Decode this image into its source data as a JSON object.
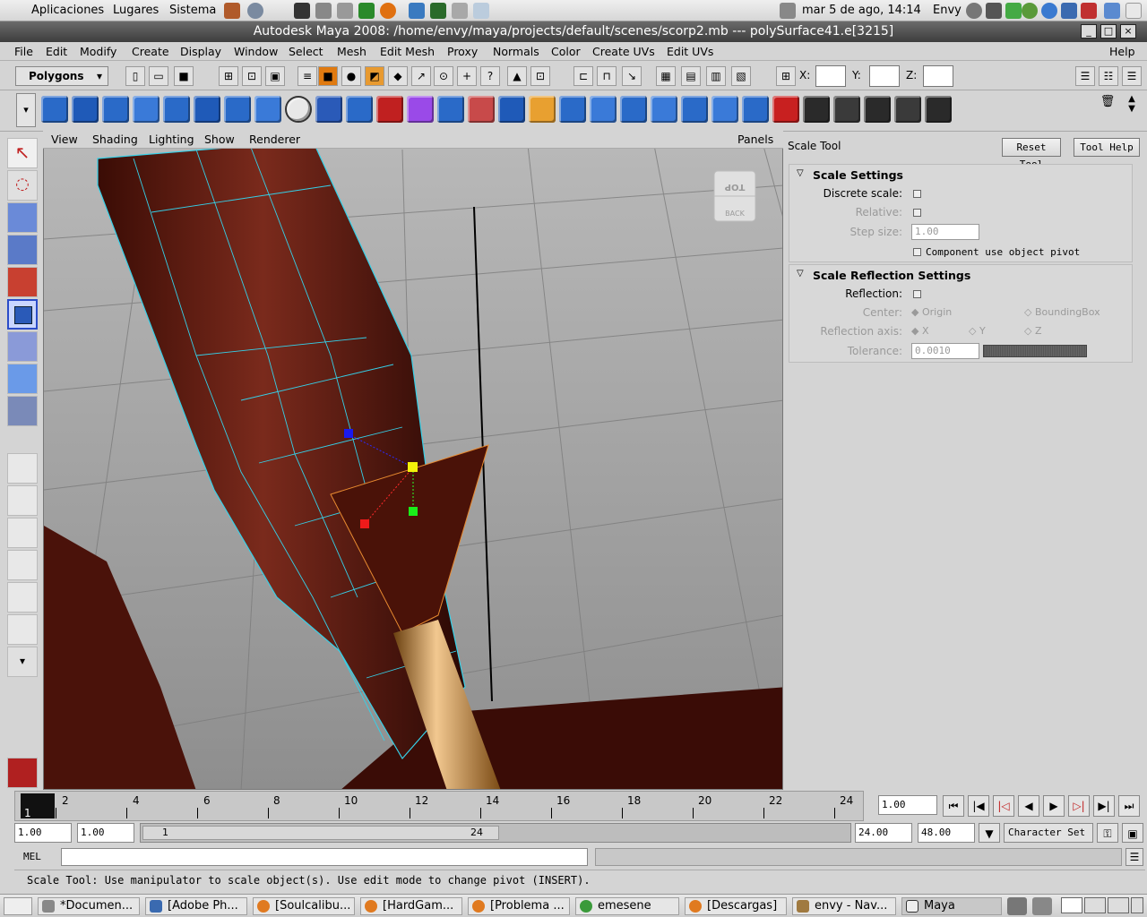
{
  "gnome_panel": {
    "menus": [
      "Aplicaciones",
      "Lugares",
      "Sistema"
    ],
    "clock": "mar  5 de ago, 14:14",
    "user": "Envy"
  },
  "window": {
    "title": "Autodesk Maya 2008: /home/envy/maya/projects/default/scenes/scorp2.mb   ---   polySurface41.e[3215]"
  },
  "menubar": [
    "File",
    "Edit",
    "Modify",
    "Create",
    "Display",
    "Window",
    "Select",
    "Mesh",
    "Edit Mesh",
    "Proxy",
    "Normals",
    "Color",
    "Create UVs",
    "Edit UVs",
    "Help"
  ],
  "status_line": {
    "menu_set": "Polygons",
    "x_label": "X:",
    "y_label": "Y:",
    "z_label": "Z:"
  },
  "viewport": {
    "menus": [
      "View",
      "Shading",
      "Lighting",
      "Show",
      "Renderer"
    ],
    "panels_label": "Panels",
    "view_cube": {
      "top": "TOP",
      "back": "BACK"
    }
  },
  "tool_settings": {
    "title": "Scale Tool",
    "reset_button": "Reset Tool",
    "help_button": "Tool Help",
    "scale_settings": {
      "header": "Scale Settings",
      "discrete_scale": "Discrete scale:",
      "relative": "Relative:",
      "step_size": "Step size:",
      "step_size_value": "1.00",
      "component_pivot": "Component use object pivot"
    },
    "reflection_settings": {
      "header": "Scale Reflection Settings",
      "reflection": "Reflection:",
      "center": "Center:",
      "center_options": [
        "Origin",
        "BoundingBox"
      ],
      "reflection_axis": "Reflection axis:",
      "axis_options": [
        "X",
        "Y",
        "Z"
      ],
      "tolerance": "Tolerance:",
      "tolerance_value": "0.0010"
    }
  },
  "timeline": {
    "current_frame_label": "1",
    "tick_labels": [
      "2",
      "4",
      "6",
      "8",
      "10",
      "12",
      "14",
      "16",
      "18",
      "20",
      "22",
      "24"
    ],
    "current_time": "1.00"
  },
  "range_slider": {
    "start": "1.00",
    "start_inner": "1.00",
    "slider_start": "1",
    "slider_end": "24",
    "end_inner": "24.00",
    "end": "48.00",
    "character_set": "Character Set"
  },
  "command_line": {
    "language": "MEL"
  },
  "help_line": "Scale Tool: Use manipulator to scale object(s). Use edit mode to change pivot (INSERT).",
  "taskbar": [
    "*Documen...",
    "[Adobe Ph...",
    "[Soulcalibu...",
    "[HardGam...",
    "[Problema ...",
    "emesene",
    "[Descargas]",
    "envy - Nav...",
    "Maya"
  ]
}
